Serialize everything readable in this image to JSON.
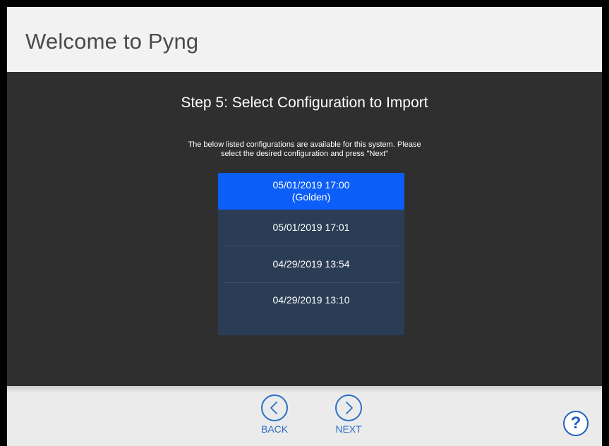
{
  "header": {
    "title": "Welcome to Pyng"
  },
  "wizard": {
    "step_title": "Step 5: Select Configuration to Import",
    "instructions_line1": "The below listed configurations are available for this system. Please",
    "instructions_line2": "select the desired configuration and press \"Next\""
  },
  "configs": [
    {
      "date": "05/01/2019 17:00",
      "note": "(Golden)",
      "selected": true
    },
    {
      "date": "05/01/2019 17:01",
      "note": "",
      "selected": false
    },
    {
      "date": "04/29/2019 13:54",
      "note": "",
      "selected": false
    },
    {
      "date": "04/29/2019 13:10",
      "note": "",
      "selected": false
    }
  ],
  "footer": {
    "back_label": "BACK",
    "next_label": "NEXT",
    "help_glyph": "?"
  },
  "icons": {
    "back": "chevron-left-circle-icon",
    "next": "chevron-right-circle-icon",
    "help": "question-circle-icon"
  },
  "colors": {
    "accent": "#2a6fc9",
    "selected_row": "#0c5ef9",
    "list_background": "#2b3d55",
    "panel_background": "#2f2f30"
  }
}
